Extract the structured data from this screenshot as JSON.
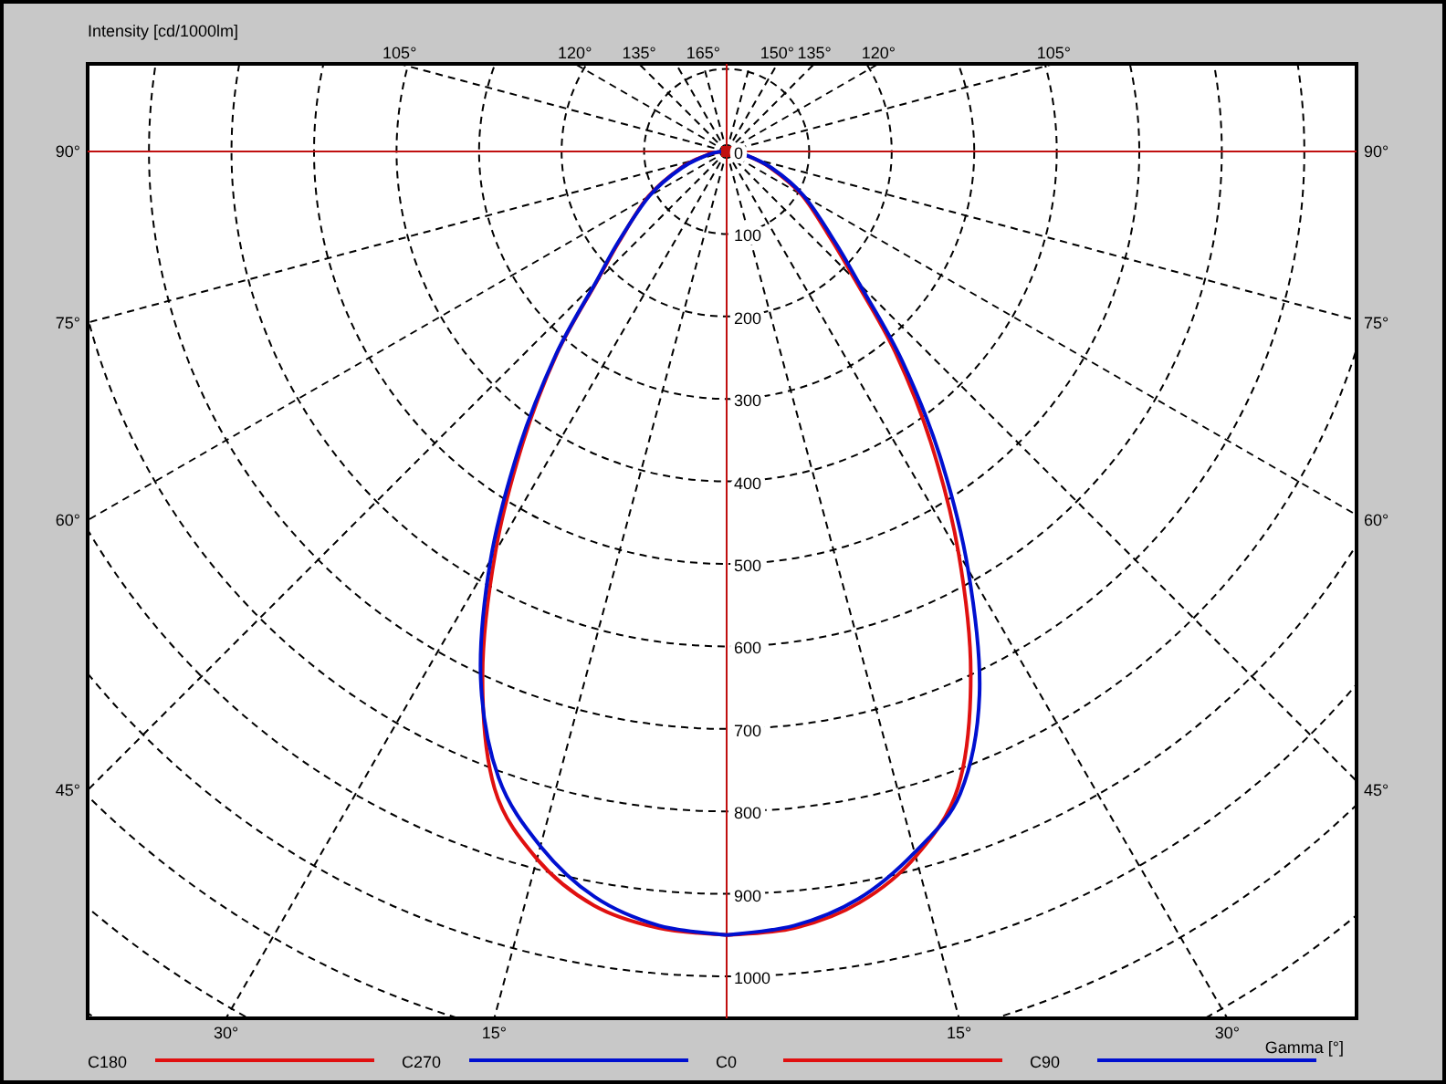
{
  "chart": {
    "intensity_title": "Intensity [cd/1000lm]",
    "gamma_title": "Gamma [°]",
    "angle_labels": {
      "top": [
        "105°",
        "120°",
        "135°",
        "165°",
        "150°",
        "135°",
        "120°",
        "105°"
      ],
      "left": [
        "90°",
        "75°",
        "60°",
        "45°"
      ],
      "right": [
        "90°",
        "75°",
        "60°",
        "45°"
      ],
      "bottom": [
        "30°",
        "15°",
        "15°",
        "30°"
      ]
    },
    "intensity_labels": [
      "0",
      "100",
      "200",
      "300",
      "400",
      "500",
      "600",
      "700",
      "800",
      "900",
      "1000"
    ],
    "legend": [
      {
        "name": "C180",
        "color": "#e01010"
      },
      {
        "name": "C270",
        "color": "#0010d0"
      },
      {
        "name": "C0",
        "color": "#e01010"
      },
      {
        "name": "C90",
        "color": "#0010d0"
      }
    ]
  }
}
